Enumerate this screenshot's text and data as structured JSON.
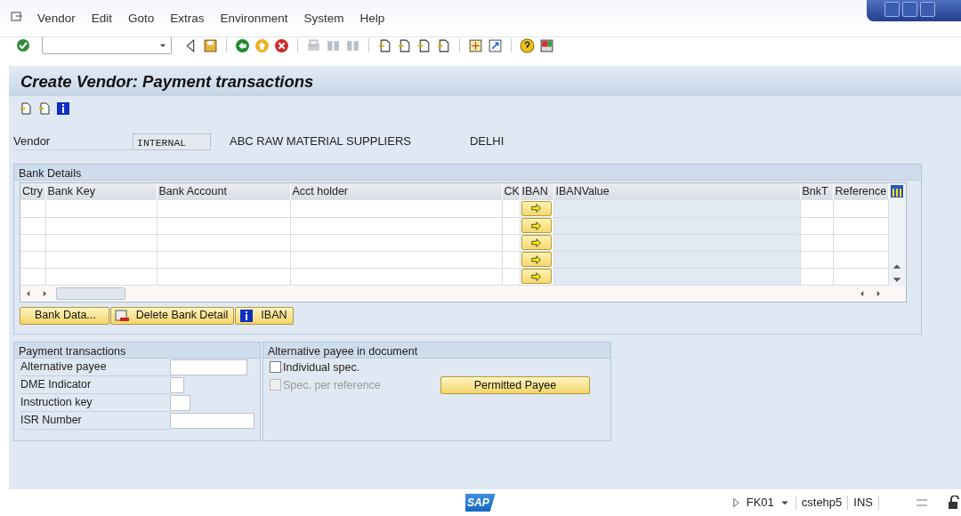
{
  "menu": [
    {
      "label": "Vendor"
    },
    {
      "label": "Edit"
    },
    {
      "label": "Goto"
    },
    {
      "label": "Extras"
    },
    {
      "label": "Environment"
    },
    {
      "label": "System"
    },
    {
      "label": "Help"
    }
  ],
  "title": "Create Vendor: Payment transactions",
  "vendor": {
    "label": "Vendor",
    "value": "INTERNAL",
    "name": "ABC RAW MATERIAL SUPPLIERS",
    "city": "DELHI"
  },
  "bank_details": {
    "title": "Bank Details",
    "columns": [
      "Ctry",
      "Bank Key",
      "Bank Account",
      "Acct holder",
      "CK",
      "IBAN",
      "IBANValue",
      "BnkT",
      "Reference"
    ],
    "buttons": [
      {
        "label": "Bank Data...",
        "kind": "plain"
      },
      {
        "label": "Delete Bank Detail",
        "kind": "delete"
      },
      {
        "label": "IBAN",
        "kind": "info"
      }
    ]
  },
  "payment_transactions": {
    "title": "Payment transactions",
    "fields": [
      {
        "label": "Alternative payee"
      },
      {
        "label": "DME Indicator"
      },
      {
        "label": "Instruction key"
      },
      {
        "label": "ISR Number"
      }
    ]
  },
  "alternative_payee": {
    "title": "Alternative payee in document",
    "checkboxes": [
      {
        "label": "Individual spec.",
        "checked": false,
        "disabled": false
      },
      {
        "label": "Spec. per reference",
        "checked": false,
        "disabled": true
      }
    ],
    "button": "Permitted Payee"
  },
  "status_bar": {
    "logo": "SAP",
    "transaction": "FK01",
    "system": "cstehp5",
    "mode": "INS"
  }
}
